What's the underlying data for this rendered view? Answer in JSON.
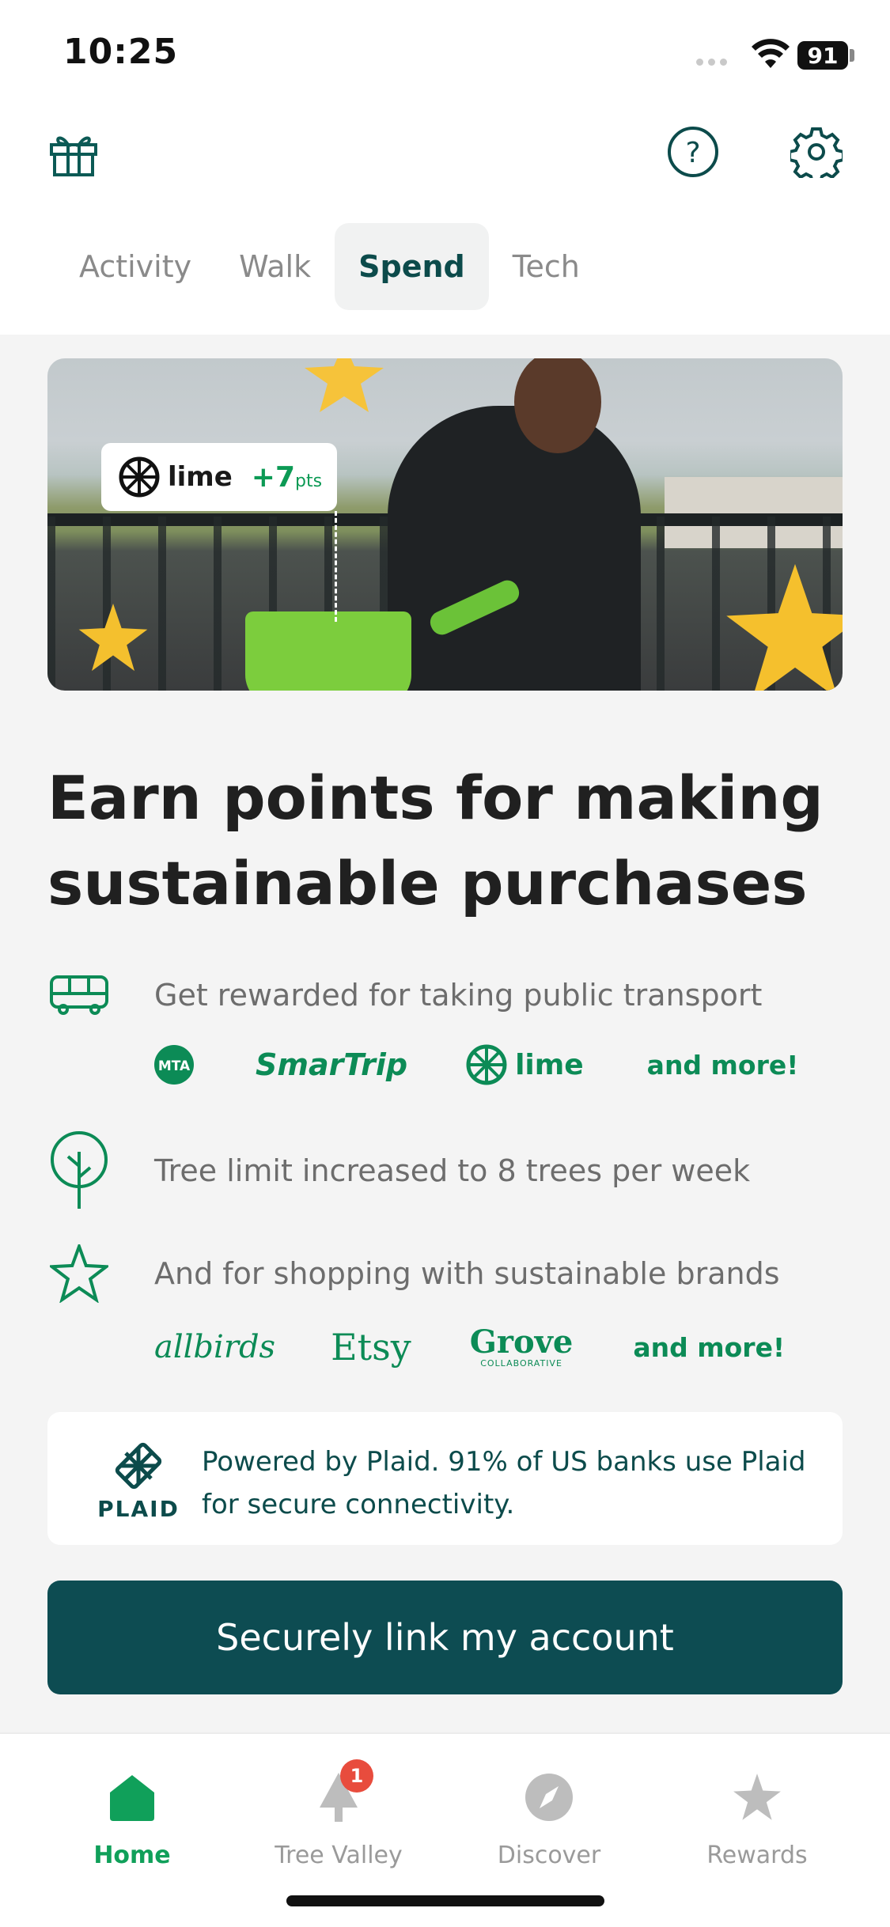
{
  "status_bar": {
    "time": "10:25",
    "battery": "91"
  },
  "header": {
    "icons": [
      "gift-icon",
      "help-icon",
      "gear-icon"
    ],
    "tabs": [
      {
        "label": "Activity",
        "active": false
      },
      {
        "label": "Walk",
        "active": false
      },
      {
        "label": "Spend",
        "active": true
      },
      {
        "label": "Tech",
        "active": false
      }
    ]
  },
  "hero": {
    "badge_brand": "lime",
    "badge_points": "+7",
    "badge_unit": "pts"
  },
  "headline": "Earn points for making sustainable purchases",
  "features": [
    {
      "icon": "bus-icon",
      "text": "Get rewarded for taking public transport"
    },
    {
      "icon": "tree-icon",
      "text": "Tree limit increased to 8 trees per week"
    },
    {
      "icon": "star-outline-icon",
      "text": "And for shopping with sustainable brands"
    }
  ],
  "transport_brands": {
    "mta": "MTA",
    "smartrip": "SmarTrip",
    "lime": "lime",
    "more": "and more!"
  },
  "shopping_brands": {
    "allbirds": "allbirds",
    "etsy": "Etsy",
    "grove": "Grove",
    "grove_sub": "COLLABORATIVE",
    "more": "and more!"
  },
  "plaid": {
    "name": "PLAID",
    "text": "Powered by Plaid. 91% of US banks use Plaid for secure connectivity."
  },
  "cta": {
    "label": "Securely link my account"
  },
  "bottom_nav": {
    "items": [
      {
        "label": "Home",
        "icon": "home-icon",
        "active": true
      },
      {
        "label": "Tree Valley",
        "icon": "tree-valley-icon",
        "badge": "1"
      },
      {
        "label": "Discover",
        "icon": "compass-icon"
      },
      {
        "label": "Rewards",
        "icon": "star-icon"
      }
    ]
  },
  "colors": {
    "brand_green": "#0c8b56",
    "dark_teal": "#0d4c52",
    "active_nav": "#10a05a",
    "badge_red": "#e84c3d"
  }
}
